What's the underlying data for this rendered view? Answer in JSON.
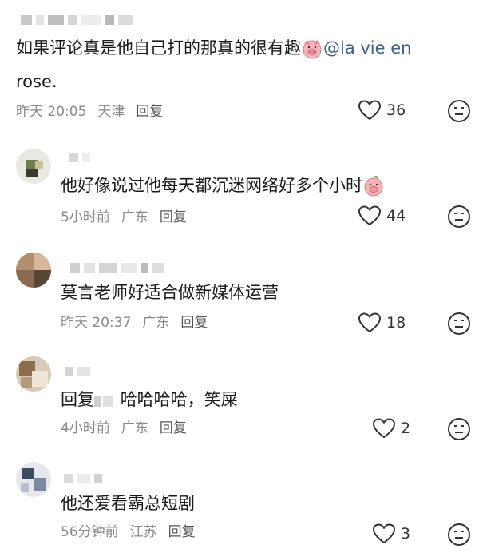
{
  "comments": [
    {
      "text": "如果评论真是他自己打的那真的很有趣",
      "mention": "@la vie en",
      "text_line2": "rose.",
      "time": "昨天 20:05",
      "location": "天津",
      "reply_label": "回复",
      "likes": "36"
    },
    {
      "text": "他好像说过他每天都沉迷网络好多个小时",
      "time": "5小时前",
      "location": "广东",
      "reply_label": "回复",
      "likes": "44"
    },
    {
      "text": "莫言老师好适合做新媒体运营",
      "time": "昨天 20:37",
      "location": "广东",
      "reply_label": "回复",
      "likes": "18"
    },
    {
      "reply_prefix": "回复",
      "text": "哈哈哈哈，笑屎",
      "time": "4小时前",
      "location": "广东",
      "reply_label": "回复",
      "likes": "2"
    },
    {
      "text": "他还爱看霸总短剧",
      "time": "56分钟前",
      "location": "江苏",
      "reply_label": "回复",
      "likes": "3"
    }
  ],
  "icons": {
    "like": "heart-outline-icon",
    "emoji": "emoji-face-icon",
    "inline_emoji": "pig-face-emoji"
  },
  "colors": {
    "mention": "#3d5f8e",
    "meta": "#8a8a8a",
    "text": "#1a1a1a"
  }
}
